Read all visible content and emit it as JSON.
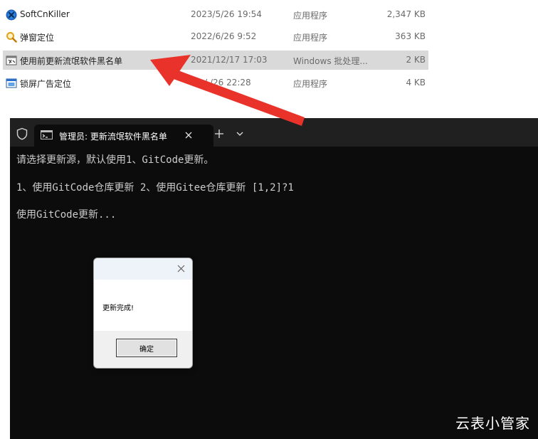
{
  "files": [
    {
      "name": "SoftCnKiller",
      "date": "2023/5/26 19:54",
      "type": "应用程序",
      "size": "2,347 KB",
      "icon": "softcnkiller-app-icon",
      "selected": false
    },
    {
      "name": "弹窗定位",
      "date": "2022/6/26 9:52",
      "type": "应用程序",
      "size": "363 KB",
      "icon": "magnifier-app-icon",
      "selected": false
    },
    {
      "name": "使用前更新流氓软件黑名单",
      "date": "2021/12/17 17:03",
      "type": "Windows 批处理...",
      "size": "2 KB",
      "icon": "batch-file-icon",
      "selected": true
    },
    {
      "name": "锁屏广告定位",
      "date": "20  /  /26 22:28",
      "type": "应用程序",
      "size": "4 KB",
      "icon": "window-app-icon",
      "selected": false
    }
  ],
  "terminal": {
    "tab_title": "管理员: 更新流氓软件黑名单",
    "lines": [
      "请选择更新源，默认使用1、GitCode更新。",
      "1、使用GitCode仓库更新 2、使用Gitee仓库更新 [1,2]?1",
      "使用GitCode更新..."
    ]
  },
  "dialog": {
    "message": "更新完成!",
    "ok_label": "确定"
  },
  "watermark": "云表小管家",
  "colors": {
    "arrow": "#e8322a",
    "terminal_bg": "#0c0c0c",
    "terminal_titlebar": "#202020",
    "terminal_text": "#cccccc",
    "selected_row": "#d9d9d9"
  }
}
